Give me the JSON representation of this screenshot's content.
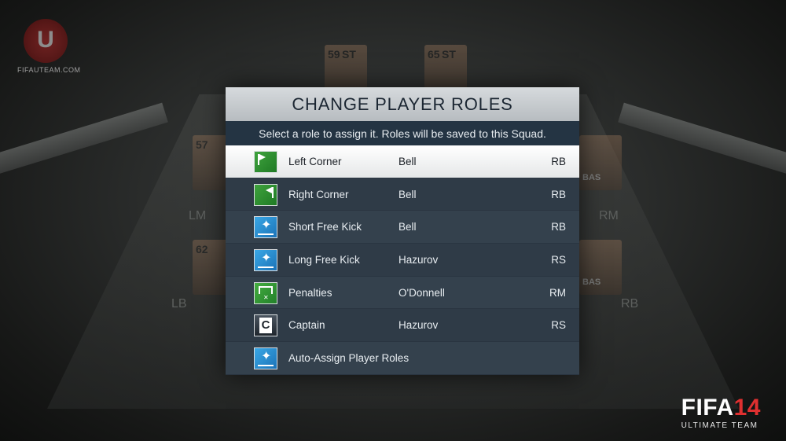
{
  "watermark": {
    "logo_letter": "U",
    "site": "FIFAUTEAM.COM"
  },
  "brand": {
    "game": "FIFA",
    "year": "14",
    "subtitle": "ULTIMATE TEAM"
  },
  "background": {
    "cards": [
      {
        "rating": "59",
        "pos": "ST"
      },
      {
        "rating": "65",
        "pos": "ST"
      },
      {
        "rating": "57",
        "pos": ""
      },
      {
        "rating": "62",
        "pos": ""
      }
    ],
    "positions": [
      "LM",
      "RM",
      "LB",
      "RB"
    ],
    "card_tags": [
      "BAS",
      "BAS"
    ]
  },
  "modal": {
    "title": "CHANGE PLAYER ROLES",
    "subtitle": "Select a role to assign it. Roles will be saved to this Squad.",
    "rows": [
      {
        "icon": "left-corner-icon",
        "label": "Left Corner",
        "player": "Bell",
        "pos": "RB",
        "selected": true
      },
      {
        "icon": "right-corner-icon",
        "label": "Right Corner",
        "player": "Bell",
        "pos": "RB",
        "selected": false
      },
      {
        "icon": "short-free-kick-icon",
        "label": "Short Free Kick",
        "player": "Bell",
        "pos": "RB",
        "selected": false
      },
      {
        "icon": "long-free-kick-icon",
        "label": "Long Free Kick",
        "player": "Hazurov",
        "pos": "RS",
        "selected": false
      },
      {
        "icon": "penalty-icon",
        "label": "Penalties",
        "player": "O'Donnell",
        "pos": "RM",
        "selected": false
      },
      {
        "icon": "captain-icon",
        "label": "Captain",
        "player": "Hazurov",
        "pos": "RS",
        "selected": false
      },
      {
        "icon": "auto-assign-icon",
        "label": "Auto-Assign Player Roles",
        "player": "",
        "pos": "",
        "selected": false
      }
    ]
  },
  "colors": {
    "header_bg": "#c7cbcf",
    "subheader_bg": "#243443",
    "row_bg": "#34414d",
    "selected_bg": "#ffffff",
    "accent_red": "#e03030"
  }
}
